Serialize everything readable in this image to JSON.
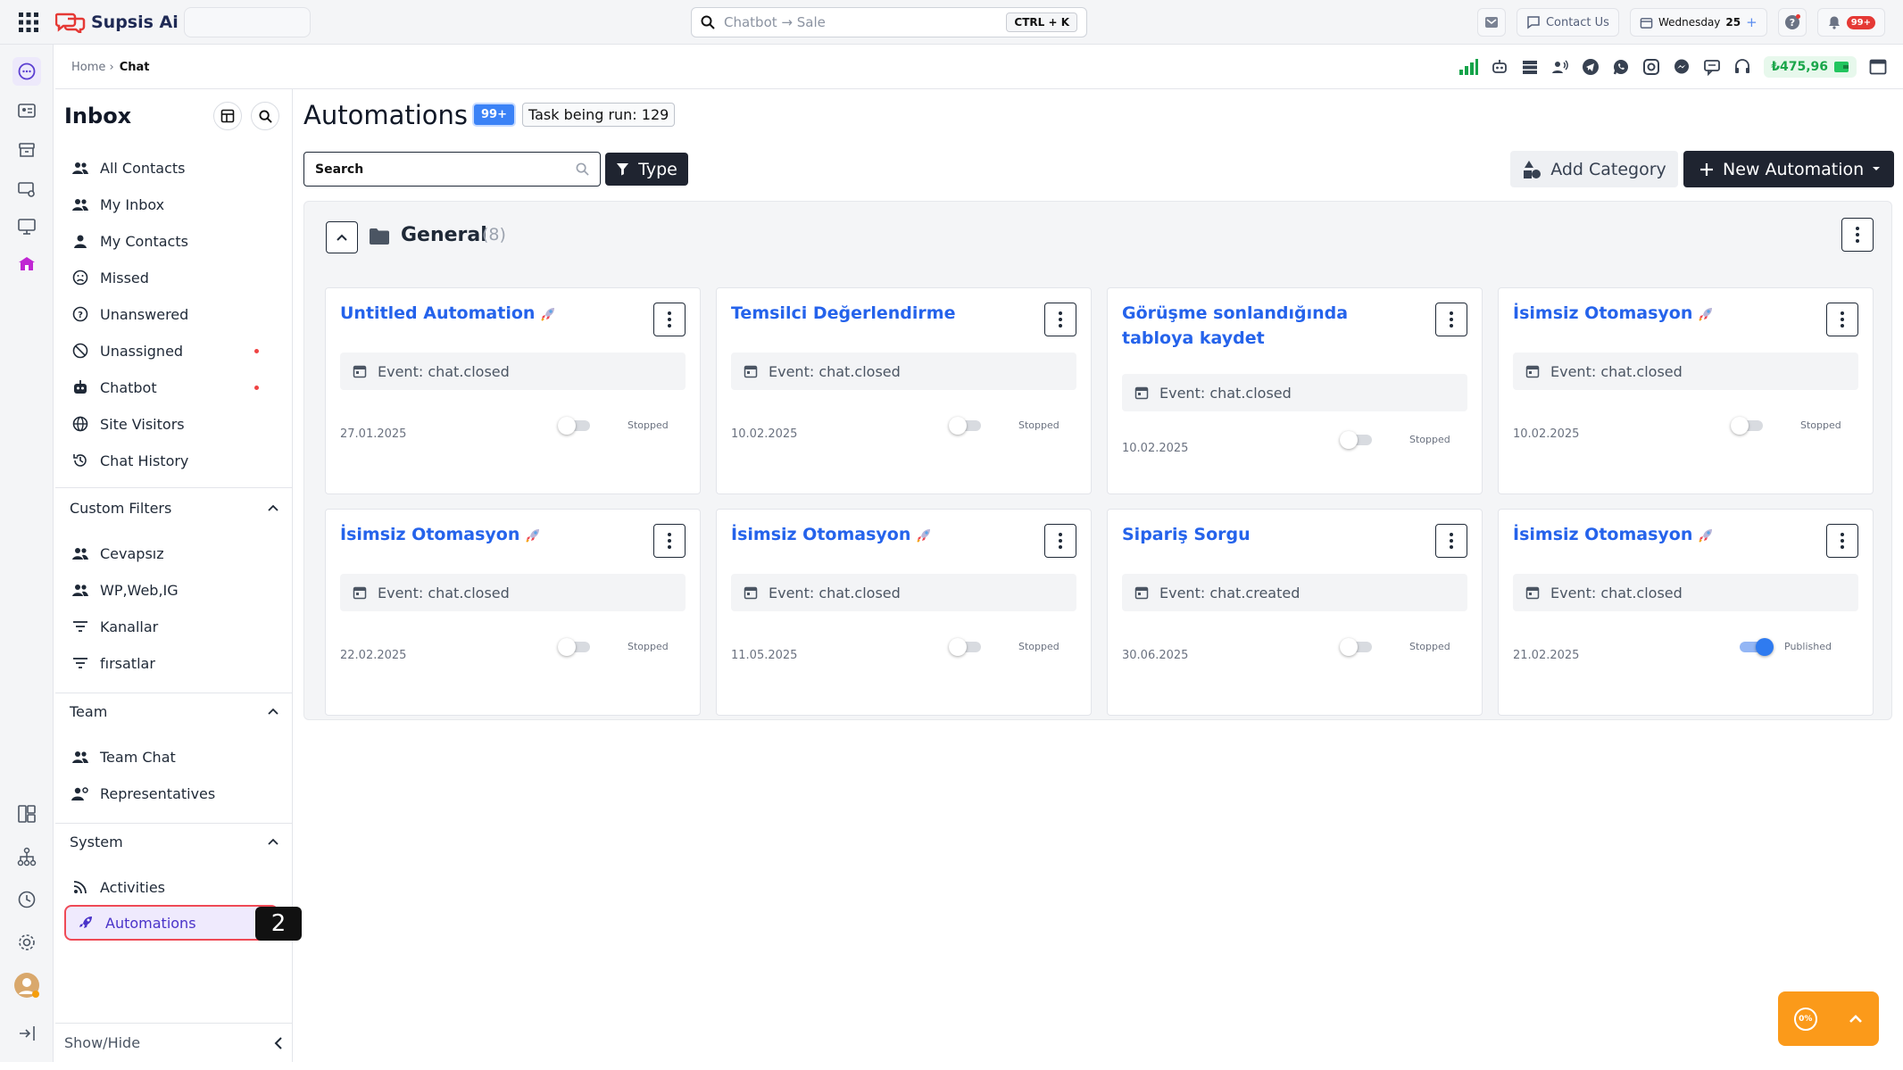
{
  "app": {
    "name": "Supsis Ai",
    "search_placeholder": "Chatbot → Sale",
    "search_shortcut": "CTRL + K",
    "contact_label": "Contact Us",
    "date_day": "Wednesday",
    "date_num": "25",
    "notifications": "99+"
  },
  "breadcrumb": {
    "home": "Home ›",
    "current": "Chat"
  },
  "balance": "₺475,96",
  "sidebar": {
    "title": "Inbox",
    "items": [
      {
        "label": "All Contacts"
      },
      {
        "label": "My Inbox"
      },
      {
        "label": "My Contacts"
      },
      {
        "label": "Missed"
      },
      {
        "label": "Unanswered"
      },
      {
        "label": "Unassigned"
      },
      {
        "label": "Chatbot"
      },
      {
        "label": "Site Visitors"
      },
      {
        "label": "Chat History"
      }
    ],
    "custom_filters": {
      "title": "Custom Filters",
      "items": [
        {
          "label": "Cevapsız"
        },
        {
          "label": "WP,Web,IG"
        },
        {
          "label": "Kanallar"
        },
        {
          "label": "fırsatlar"
        }
      ]
    },
    "team": {
      "title": "Team",
      "items": [
        {
          "label": "Team Chat"
        },
        {
          "label": "Representatives"
        }
      ]
    },
    "system": {
      "title": "System",
      "items": [
        {
          "label": "Activities"
        },
        {
          "label": "Automations"
        }
      ]
    },
    "step_marker": "2",
    "show_hide": "Show/Hide"
  },
  "main": {
    "title": "Automations",
    "count": "99+",
    "task_label": "Task being run: 129",
    "search_placeholder": "Search",
    "type_label": "Type",
    "add_category_label": "Add Category",
    "new_automation_label": "New Automation",
    "group": {
      "name": "General",
      "count": "(8)",
      "cards": [
        {
          "title": "Untitled Automation",
          "event": "Event: chat.closed",
          "date": "27.01.2025",
          "status": "Stopped",
          "on": false,
          "rocket": true
        },
        {
          "title": "Temsilci Değerlendirme",
          "event": "Event: chat.closed",
          "date": "10.02.2025",
          "status": "Stopped",
          "on": false,
          "rocket": false
        },
        {
          "title": "Görüşme sonlandığında tabloya kaydet",
          "event": "Event: chat.closed",
          "date": "10.02.2025",
          "status": "Stopped",
          "on": false,
          "rocket": false
        },
        {
          "title": "İsimsiz Otomasyon",
          "event": "Event: chat.closed",
          "date": "10.02.2025",
          "status": "Stopped",
          "on": false,
          "rocket": true
        },
        {
          "title": "İsimsiz Otomasyon",
          "event": "Event: chat.closed",
          "date": "22.02.2025",
          "status": "Stopped",
          "on": false,
          "rocket": true
        },
        {
          "title": "İsimsiz Otomasyon",
          "event": "Event: chat.closed",
          "date": "11.05.2025",
          "status": "Stopped",
          "on": false,
          "rocket": true
        },
        {
          "title": "Sipariş Sorgu",
          "event": "Event: chat.created",
          "date": "30.06.2025",
          "status": "Stopped",
          "on": false,
          "rocket": false
        },
        {
          "title": "İsimsiz Otomasyon",
          "event": "Event: chat.closed",
          "date": "21.02.2025",
          "status": "Published",
          "on": true,
          "rocket": true
        }
      ]
    }
  },
  "progress_widget": {
    "percent": "0%"
  },
  "colors": {
    "accent": "#2563eb",
    "primary_dark": "#1f2430",
    "active_item": "#4a33c9",
    "highlight_border": "#ef4a56",
    "widget": "#fb9a1a"
  }
}
